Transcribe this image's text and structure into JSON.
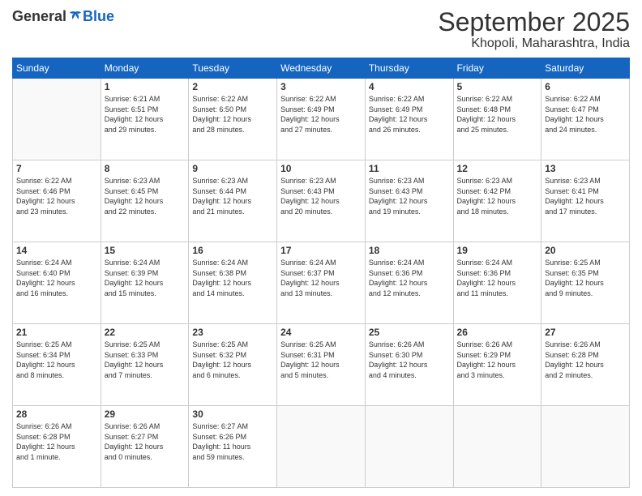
{
  "header": {
    "logo_general": "General",
    "logo_blue": "Blue",
    "month": "September 2025",
    "location": "Khopoli, Maharashtra, India"
  },
  "weekdays": [
    "Sunday",
    "Monday",
    "Tuesday",
    "Wednesday",
    "Thursday",
    "Friday",
    "Saturday"
  ],
  "weeks": [
    [
      {
        "day": "",
        "info": ""
      },
      {
        "day": "1",
        "info": "Sunrise: 6:21 AM\nSunset: 6:51 PM\nDaylight: 12 hours\nand 29 minutes."
      },
      {
        "day": "2",
        "info": "Sunrise: 6:22 AM\nSunset: 6:50 PM\nDaylight: 12 hours\nand 28 minutes."
      },
      {
        "day": "3",
        "info": "Sunrise: 6:22 AM\nSunset: 6:49 PM\nDaylight: 12 hours\nand 27 minutes."
      },
      {
        "day": "4",
        "info": "Sunrise: 6:22 AM\nSunset: 6:49 PM\nDaylight: 12 hours\nand 26 minutes."
      },
      {
        "day": "5",
        "info": "Sunrise: 6:22 AM\nSunset: 6:48 PM\nDaylight: 12 hours\nand 25 minutes."
      },
      {
        "day": "6",
        "info": "Sunrise: 6:22 AM\nSunset: 6:47 PM\nDaylight: 12 hours\nand 24 minutes."
      }
    ],
    [
      {
        "day": "7",
        "info": "Sunrise: 6:22 AM\nSunset: 6:46 PM\nDaylight: 12 hours\nand 23 minutes."
      },
      {
        "day": "8",
        "info": "Sunrise: 6:23 AM\nSunset: 6:45 PM\nDaylight: 12 hours\nand 22 minutes."
      },
      {
        "day": "9",
        "info": "Sunrise: 6:23 AM\nSunset: 6:44 PM\nDaylight: 12 hours\nand 21 minutes."
      },
      {
        "day": "10",
        "info": "Sunrise: 6:23 AM\nSunset: 6:43 PM\nDaylight: 12 hours\nand 20 minutes."
      },
      {
        "day": "11",
        "info": "Sunrise: 6:23 AM\nSunset: 6:43 PM\nDaylight: 12 hours\nand 19 minutes."
      },
      {
        "day": "12",
        "info": "Sunrise: 6:23 AM\nSunset: 6:42 PM\nDaylight: 12 hours\nand 18 minutes."
      },
      {
        "day": "13",
        "info": "Sunrise: 6:23 AM\nSunset: 6:41 PM\nDaylight: 12 hours\nand 17 minutes."
      }
    ],
    [
      {
        "day": "14",
        "info": "Sunrise: 6:24 AM\nSunset: 6:40 PM\nDaylight: 12 hours\nand 16 minutes."
      },
      {
        "day": "15",
        "info": "Sunrise: 6:24 AM\nSunset: 6:39 PM\nDaylight: 12 hours\nand 15 minutes."
      },
      {
        "day": "16",
        "info": "Sunrise: 6:24 AM\nSunset: 6:38 PM\nDaylight: 12 hours\nand 14 minutes."
      },
      {
        "day": "17",
        "info": "Sunrise: 6:24 AM\nSunset: 6:37 PM\nDaylight: 12 hours\nand 13 minutes."
      },
      {
        "day": "18",
        "info": "Sunrise: 6:24 AM\nSunset: 6:36 PM\nDaylight: 12 hours\nand 12 minutes."
      },
      {
        "day": "19",
        "info": "Sunrise: 6:24 AM\nSunset: 6:36 PM\nDaylight: 12 hours\nand 11 minutes."
      },
      {
        "day": "20",
        "info": "Sunrise: 6:25 AM\nSunset: 6:35 PM\nDaylight: 12 hours\nand 9 minutes."
      }
    ],
    [
      {
        "day": "21",
        "info": "Sunrise: 6:25 AM\nSunset: 6:34 PM\nDaylight: 12 hours\nand 8 minutes."
      },
      {
        "day": "22",
        "info": "Sunrise: 6:25 AM\nSunset: 6:33 PM\nDaylight: 12 hours\nand 7 minutes."
      },
      {
        "day": "23",
        "info": "Sunrise: 6:25 AM\nSunset: 6:32 PM\nDaylight: 12 hours\nand 6 minutes."
      },
      {
        "day": "24",
        "info": "Sunrise: 6:25 AM\nSunset: 6:31 PM\nDaylight: 12 hours\nand 5 minutes."
      },
      {
        "day": "25",
        "info": "Sunrise: 6:26 AM\nSunset: 6:30 PM\nDaylight: 12 hours\nand 4 minutes."
      },
      {
        "day": "26",
        "info": "Sunrise: 6:26 AM\nSunset: 6:29 PM\nDaylight: 12 hours\nand 3 minutes."
      },
      {
        "day": "27",
        "info": "Sunrise: 6:26 AM\nSunset: 6:28 PM\nDaylight: 12 hours\nand 2 minutes."
      }
    ],
    [
      {
        "day": "28",
        "info": "Sunrise: 6:26 AM\nSunset: 6:28 PM\nDaylight: 12 hours\nand 1 minute."
      },
      {
        "day": "29",
        "info": "Sunrise: 6:26 AM\nSunset: 6:27 PM\nDaylight: 12 hours\nand 0 minutes."
      },
      {
        "day": "30",
        "info": "Sunrise: 6:27 AM\nSunset: 6:26 PM\nDaylight: 11 hours\nand 59 minutes."
      },
      {
        "day": "",
        "info": ""
      },
      {
        "day": "",
        "info": ""
      },
      {
        "day": "",
        "info": ""
      },
      {
        "day": "",
        "info": ""
      }
    ]
  ]
}
